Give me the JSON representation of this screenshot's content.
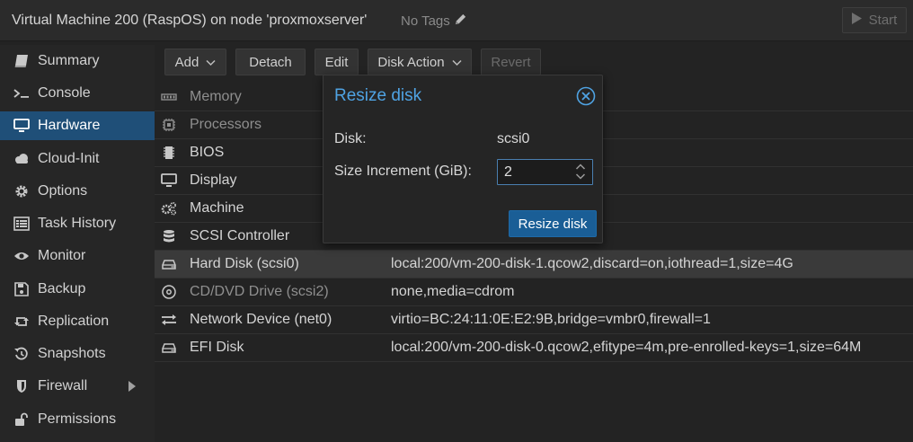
{
  "header": {
    "vm_title": "Virtual Machine 200 (RaspOS) on node 'proxmoxserver'",
    "tags": "No Tags",
    "start_label": "Start"
  },
  "sidebar": {
    "items": [
      {
        "label": "Summary",
        "icon": "book-icon"
      },
      {
        "label": "Console",
        "icon": "terminal-icon"
      },
      {
        "label": "Hardware",
        "icon": "monitor-icon",
        "active": true
      },
      {
        "label": "Cloud-Init",
        "icon": "cloud-icon"
      },
      {
        "label": "Options",
        "icon": "gear-icon"
      },
      {
        "label": "Task History",
        "icon": "list-icon"
      },
      {
        "label": "Monitor",
        "icon": "eye-icon"
      },
      {
        "label": "Backup",
        "icon": "floppy-icon"
      },
      {
        "label": "Replication",
        "icon": "retweet-icon"
      },
      {
        "label": "Snapshots",
        "icon": "history-icon"
      },
      {
        "label": "Firewall",
        "icon": "shield-icon"
      },
      {
        "label": "Permissions",
        "icon": "unlock-icon"
      }
    ]
  },
  "toolbar": {
    "add": "Add",
    "detach": "Detach",
    "edit": "Edit",
    "disk_action": "Disk Action",
    "revert": "Revert"
  },
  "hardware": {
    "rows": [
      {
        "name": "Memory",
        "value": "",
        "icon": "memory-icon"
      },
      {
        "name": "Processors",
        "value": "",
        "icon": "cpu-icon"
      },
      {
        "name": "BIOS",
        "value": "",
        "icon": "chip-icon"
      },
      {
        "name": "Display",
        "value": "",
        "icon": "desktop-icon"
      },
      {
        "name": "Machine",
        "value": "",
        "icon": "cogs-icon"
      },
      {
        "name": "SCSI Controller",
        "value": "",
        "icon": "database-icon"
      },
      {
        "name": "Hard Disk (scsi0)",
        "value": "local:200/vm-200-disk-1.qcow2,discard=on,iothread=1,size=4G",
        "icon": "hdd-icon"
      },
      {
        "name": "CD/DVD Drive (scsi2)",
        "value": "none,media=cdrom",
        "icon": "disc-icon"
      },
      {
        "name": "Network Device (net0)",
        "value": "virtio=BC:24:11:0E:E2:9B,bridge=vmbr0,firewall=1",
        "icon": "exchange-icon"
      },
      {
        "name": "EFI Disk",
        "value": "local:200/vm-200-disk-0.qcow2,efitype=4m,pre-enrolled-keys=1,size=64M",
        "icon": "hdd-icon"
      }
    ]
  },
  "modal": {
    "title": "Resize disk",
    "disk_label": "Disk:",
    "disk_value": "scsi0",
    "size_label": "Size Increment (GiB):",
    "size_value": "2",
    "submit": "Resize disk"
  },
  "colors": {
    "accent": "#1f4f78",
    "title_blue": "#4fa3e3",
    "primary_button": "#1a5e96"
  }
}
